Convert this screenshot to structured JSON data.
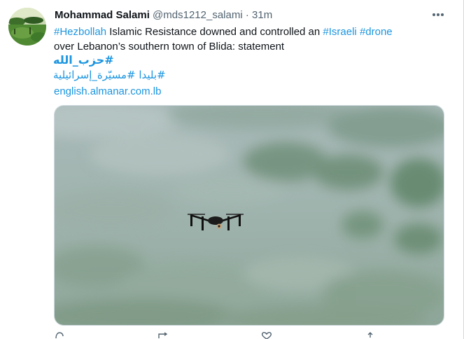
{
  "tweet": {
    "author_name": "Mohammad Salami",
    "handle": "@mds1212_salami",
    "separator": "·",
    "time": "31m",
    "more_icon": "ellipsis-icon",
    "text": {
      "line1": [
        {
          "kind": "tag",
          "value": "#Hezbollah"
        },
        {
          "kind": "text",
          "value": " Islamic Resistance downed and controlled an "
        },
        {
          "kind": "tag",
          "value": "#Israeli"
        },
        {
          "kind": "text",
          "value": " "
        },
        {
          "kind": "tag",
          "value": "#drone"
        }
      ],
      "line2": "over Lebanon’s southern town of Blida: statement",
      "arabic_tag_1": "#حزب_الله",
      "arabic_tags_2": "#بليدا #مسيّرة_إسرائيلية",
      "link": "english.almanar.com.lb"
    },
    "media": {
      "kind": "photo",
      "subject": "drone-in-flight"
    },
    "actions": [
      "reply-icon",
      "retweet-icon",
      "like-icon",
      "share-icon"
    ]
  },
  "colors": {
    "link": "#1b95e0",
    "text": "#0f1419",
    "muted": "#536471"
  }
}
